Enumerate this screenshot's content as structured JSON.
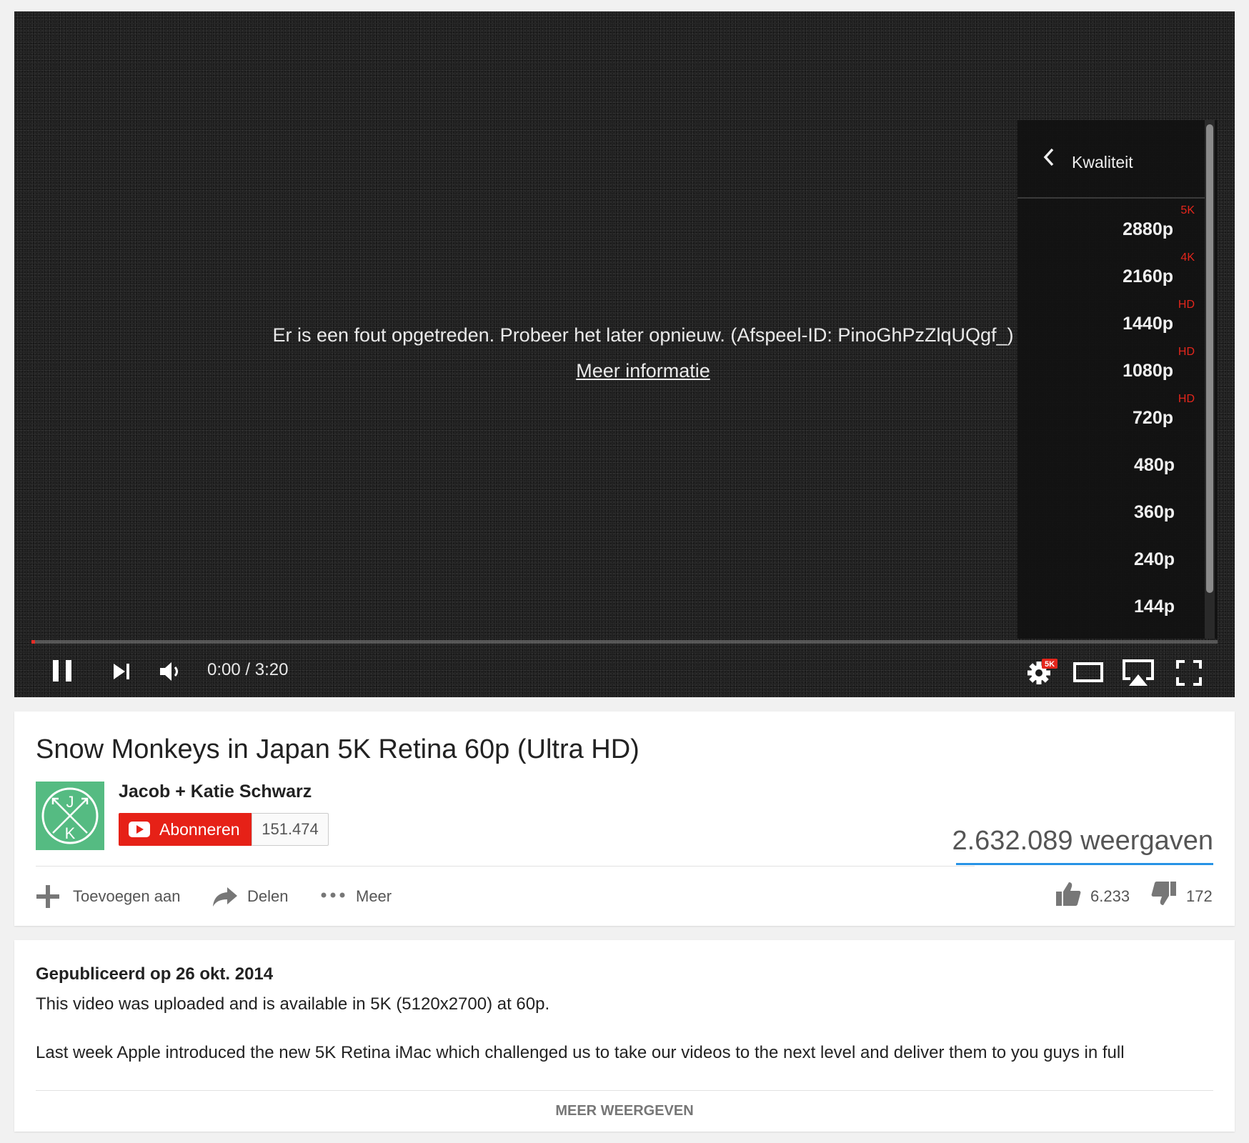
{
  "player": {
    "error_message": "Er is een fout opgetreden. Probeer het later opnieuw. (Afspeel-ID: PinoGhPzZlqUQgf_)",
    "more_info_link": "Meer informatie",
    "time_display": "0:00 / 3:20",
    "progress": 0.003,
    "quality_badge": "5K",
    "quality_menu": {
      "title": "Kwaliteit",
      "items": [
        {
          "label": "2880p",
          "badge": "5K"
        },
        {
          "label": "2160p",
          "badge": "4K"
        },
        {
          "label": "1440p",
          "badge": "HD"
        },
        {
          "label": "1080p",
          "badge": "HD"
        },
        {
          "label": "720p",
          "badge": "HD"
        },
        {
          "label": "480p",
          "badge": ""
        },
        {
          "label": "360p",
          "badge": ""
        },
        {
          "label": "240p",
          "badge": ""
        },
        {
          "label": "144p",
          "badge": ""
        }
      ]
    },
    "icons": {
      "pause": "pause-icon",
      "next": "next-icon",
      "volume": "volume-icon",
      "settings": "gear-icon",
      "theater": "theater-mode-icon",
      "airplay": "airplay-icon",
      "fullscreen": "fullscreen-icon"
    }
  },
  "video": {
    "title": "Snow Monkeys in Japan 5K Retina 60p (Ultra HD)",
    "channel": {
      "name": "Jacob + Katie Schwarz",
      "avatar_text_top": "J",
      "avatar_text_bottom": "K",
      "avatar_color": "#55bb82"
    },
    "subscribe_label": "Abonneren",
    "subscriber_count": "151.474",
    "views": "2.632.089 weergaven",
    "actions": {
      "add_to": "Toevoegen aan",
      "share": "Delen",
      "more": "Meer"
    },
    "likes": "6.233",
    "dislikes": "172"
  },
  "description": {
    "published": "Gepubliceerd op 26 okt. 2014",
    "line1": "This video was uploaded and is available in 5K (5120x2700) at 60p.",
    "line2": "Last week Apple introduced the new 5K Retina iMac which challenged us to take our videos to the next level and deliver them to you guys in full",
    "show_more": "MEER WEERGEVEN"
  },
  "colors": {
    "accent_red": "#e62117",
    "badge_red": "#e4261c",
    "views_bar_blue": "#2793e6"
  }
}
